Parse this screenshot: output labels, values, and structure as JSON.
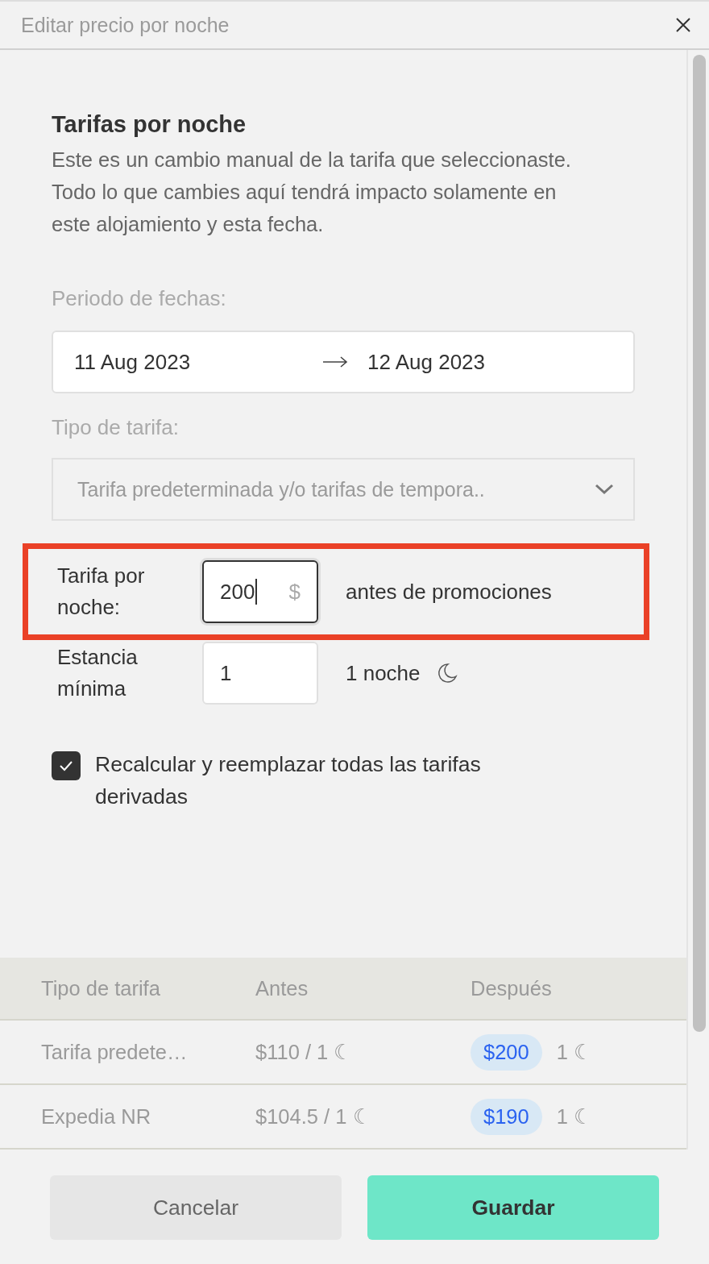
{
  "dialog": {
    "title": "Editar precio por noche"
  },
  "intro": {
    "heading": "Tarifas por noche",
    "text": "Este es un cambio manual de la tarifa que seleccionaste. Todo lo que cambies aquí tendrá impacto solamente en este alojamiento y esta fecha."
  },
  "date_range": {
    "label": "Periodo de fechas:",
    "start": "11 Aug 2023",
    "end": "12 Aug 2023"
  },
  "rate_type": {
    "label": "Tipo de tarifa:",
    "value": "Tarifa predeterminada y/o tarifas de tempora..",
    "disabled": true
  },
  "fields": [
    {
      "kind": "price",
      "label": "Tarifa por noche:",
      "value": "200",
      "currency": "$",
      "note": "antes de promociones",
      "highlighted": true,
      "focused": true
    },
    {
      "kind": "nights",
      "label": "Estancia mínima",
      "value": "1",
      "note": "1 noche",
      "highlighted": false,
      "focused": false
    }
  ],
  "recalculate": {
    "label": "Recalcular y reemplazar todas las tarifas derivadas",
    "checked": true
  },
  "table": {
    "columns": [
      "Tipo de tarifa",
      "Antes",
      "Después"
    ],
    "rows": [
      {
        "name": "Tarifa predete…",
        "before": "$110 / 1 ☾",
        "after": "$200",
        "after_nights": "1 ☾"
      },
      {
        "name": "Expedia NR",
        "before": "$104.5 / 1 ☾",
        "after": "$190",
        "after_nights": "1 ☾"
      }
    ]
  },
  "buttons": [
    {
      "label": "Cancelar",
      "kind": "secondary"
    },
    {
      "label": "Guardar",
      "kind": "primary"
    }
  ]
}
